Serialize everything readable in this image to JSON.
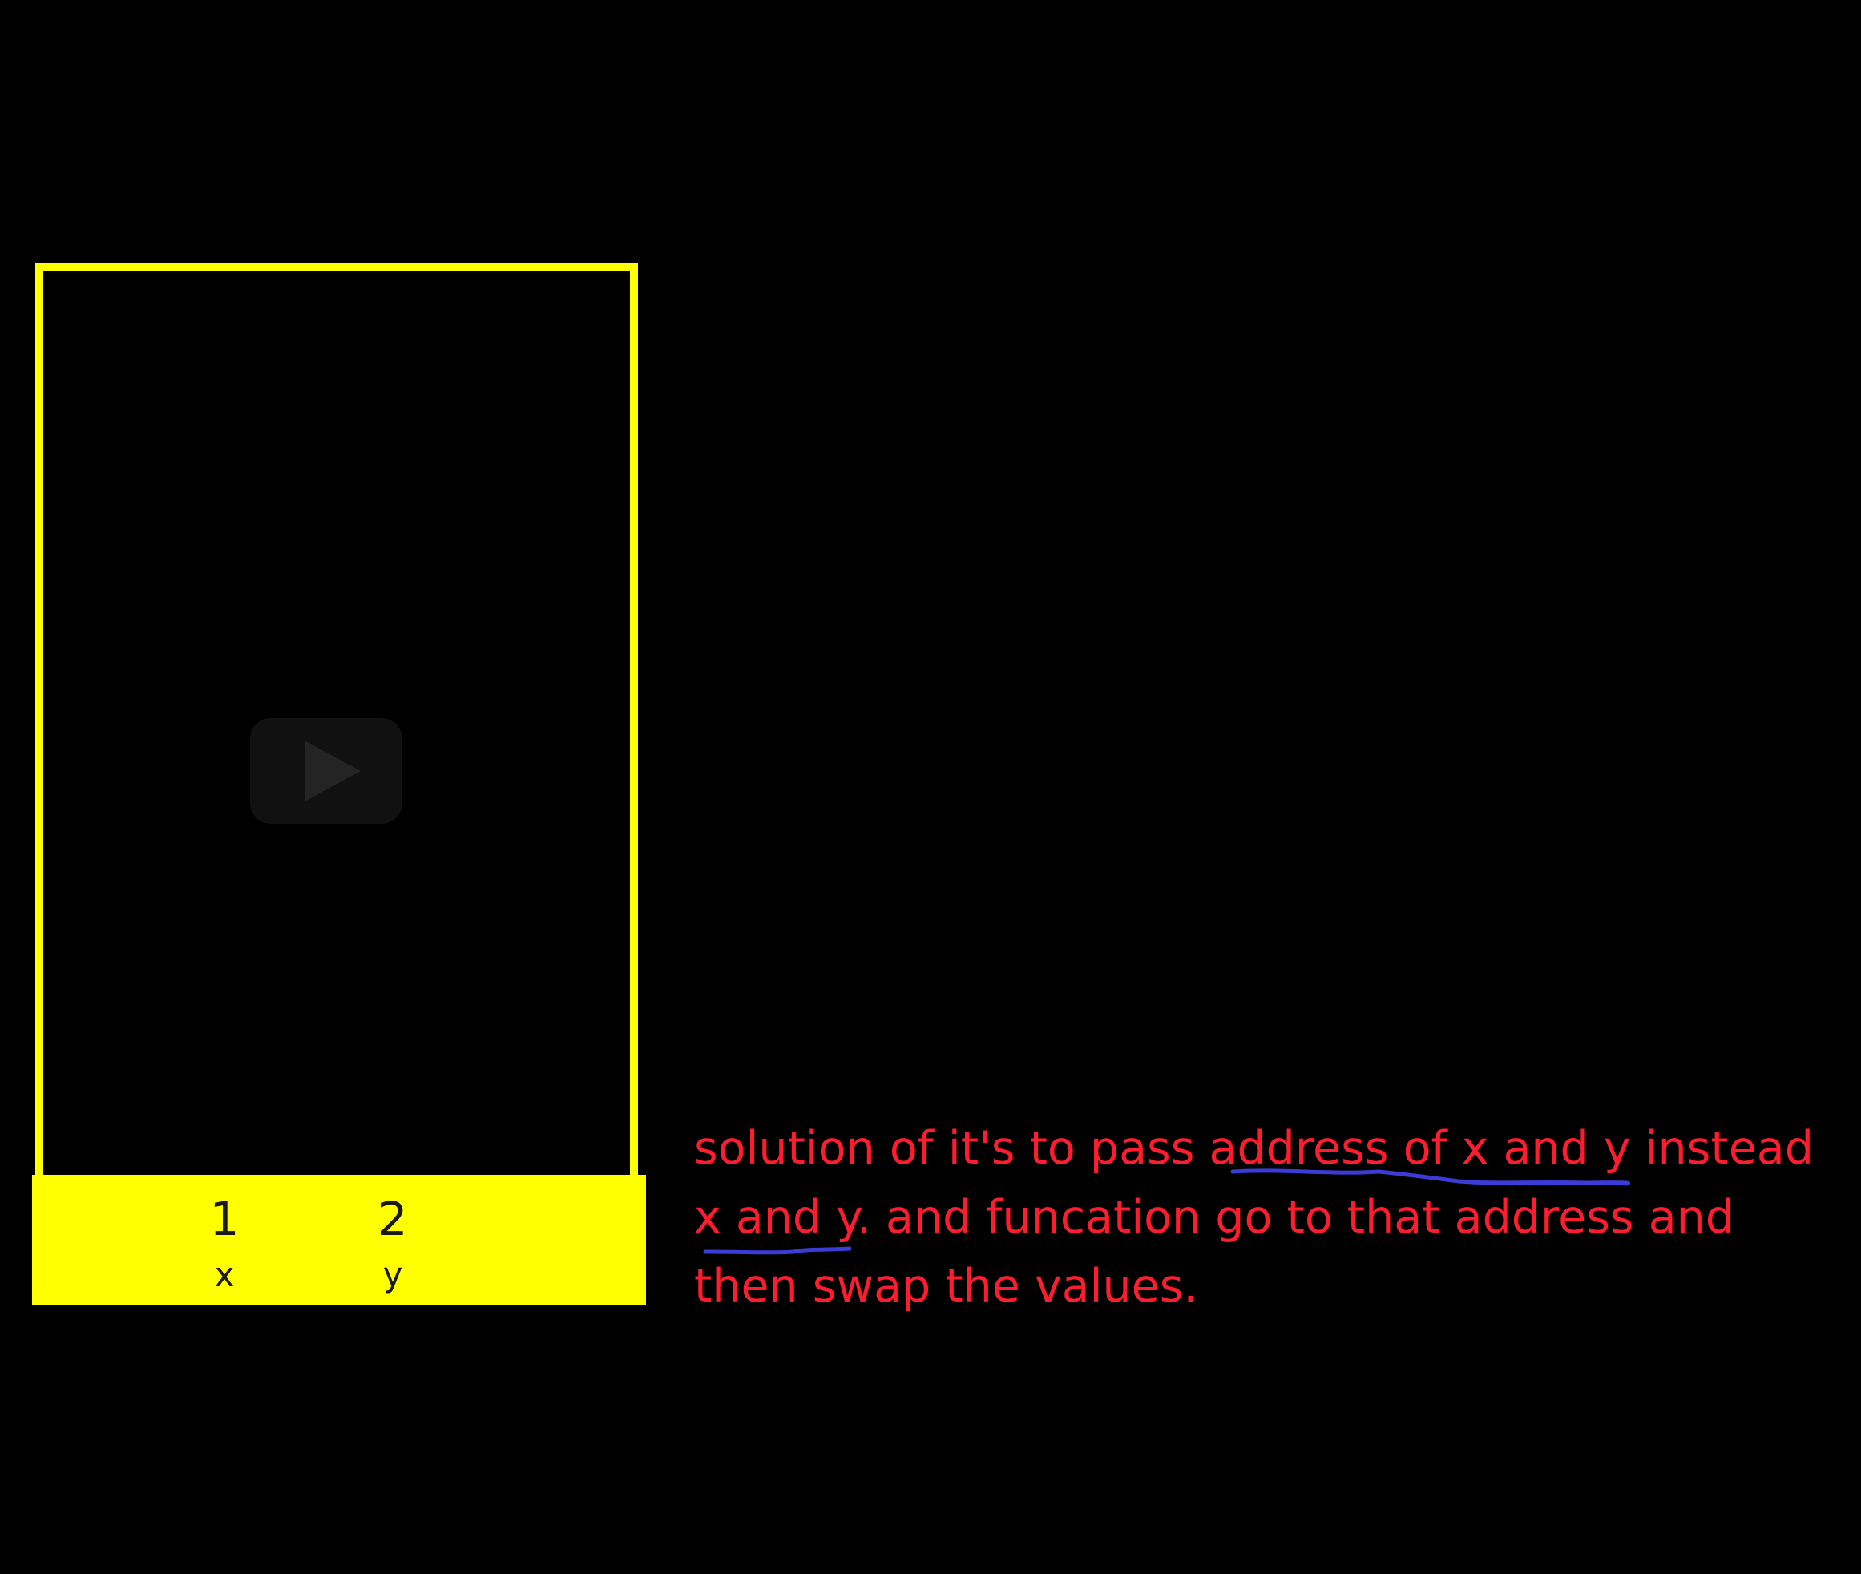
{
  "diagram": {
    "memory_cells": [
      {
        "value": "1",
        "name": "x"
      },
      {
        "value": "2",
        "name": "y"
      }
    ],
    "play_icon": "play-icon",
    "colors": {
      "frame": "#ffff00",
      "annotation": "#ff1d2d",
      "underline": "#3b3bd6",
      "background": "#000000"
    }
  },
  "annotation": {
    "lines": [
      "solution of it's to pass address of x and y instead",
      "x and y. and funcation go to that address and",
      "then swap the values."
    ]
  }
}
